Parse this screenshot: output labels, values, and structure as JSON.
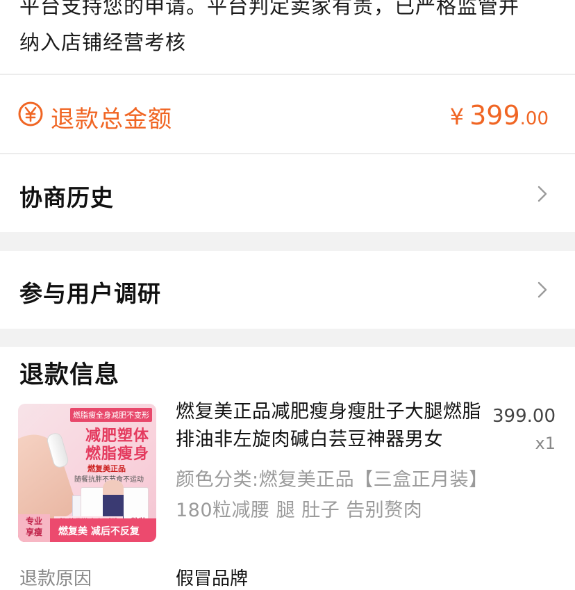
{
  "decision": {
    "line1": "平台支持您的申请。平台判定卖家有责，已严格监管并",
    "line2": "纳入店铺经营考核"
  },
  "refund_total": {
    "icon": "yuan-coin-icon",
    "label": "退款总金额",
    "currency": "¥",
    "amount_int": "399",
    "amount_dec": ".00",
    "accent": "#f06523"
  },
  "history": {
    "label": "协商历史",
    "icon": "chevron-right-icon"
  },
  "survey": {
    "label": "参与用户调研",
    "icon": "chevron-right-icon"
  },
  "refund_info": {
    "title": "退款信息",
    "product": {
      "name": "燃复美正品减肥瘦身瘦肚子大腿燃脂排油非左旋肉碱白芸豆神器男女",
      "price": "399.00",
      "qty": "x1",
      "spec": "颜色分类:燃复美正品【三盒正月装】180粒减腰 腿 肚子 告别赘肉",
      "thumb": {
        "tag": "燃脂瘦全身减肥不变形",
        "headline1": "减肥塑体",
        "headline2": "燃脂瘦身",
        "brand": "燃复美正品",
        "sub": "随餐抗胖不节食不运动",
        "badge1": "专业",
        "badge2": "享瘦",
        "strip_text": "燃复美 减后不反复",
        "small_line": "【加快代谢 多吃不胖】",
        "count": "60粒装"
      }
    },
    "reason_label": "退款原因",
    "reason_value": "假冒品牌"
  }
}
